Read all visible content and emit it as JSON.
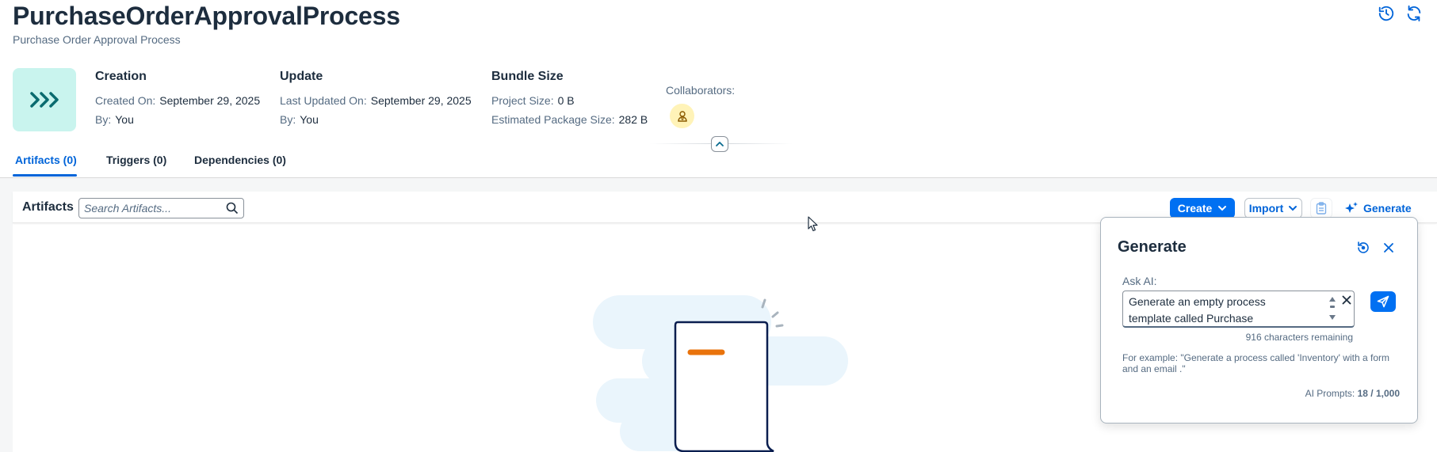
{
  "header": {
    "title": "PurchaseOrderApprovalProcess",
    "subtitle": "Purchase Order Approval Process",
    "icons": [
      "history-icon",
      "refresh-icon"
    ]
  },
  "creation": {
    "title": "Creation",
    "created_on_label": "Created On:",
    "created_on_value": "September 29, 2025",
    "by_label": "By:",
    "by_value": "You"
  },
  "update": {
    "title": "Update",
    "last_updated_label": "Last Updated On:",
    "last_updated_value": "September 29, 2025",
    "by_label": "By:",
    "by_value": "You"
  },
  "bundle": {
    "title": "Bundle Size",
    "project_size_label": "Project Size:",
    "project_size_value": "0 B",
    "estimated_label": "Estimated Package Size:",
    "estimated_value": "282 B"
  },
  "collaborators": {
    "label": "Collaborators:"
  },
  "tabs": [
    {
      "label": "Artifacts (0)",
      "active": true
    },
    {
      "label": "Triggers (0)",
      "active": false
    },
    {
      "label": "Dependencies (0)",
      "active": false
    }
  ],
  "artifacts": {
    "title": "Artifacts",
    "search_placeholder": "Search Artifacts...",
    "create_label": "Create",
    "import_label": "Import",
    "generate_label": "Generate"
  },
  "generate_popover": {
    "title": "Generate",
    "ask_label": "Ask AI:",
    "prompt_text": "Generate an empty process template called Purchase Requisition with an",
    "chars_remaining": "916 characters remaining",
    "example": "For example: \"Generate a process called 'Inventory' with a form and an email .\"",
    "ai_prompts_label": "AI Prompts:",
    "ai_prompts_value": "18 / 1,000"
  },
  "colors": {
    "accent": "#0070f2",
    "link": "#0064d9",
    "tile": "#c9f4ee",
    "avatar": "#fff3b8",
    "illustration_orange": "#e9730c"
  }
}
